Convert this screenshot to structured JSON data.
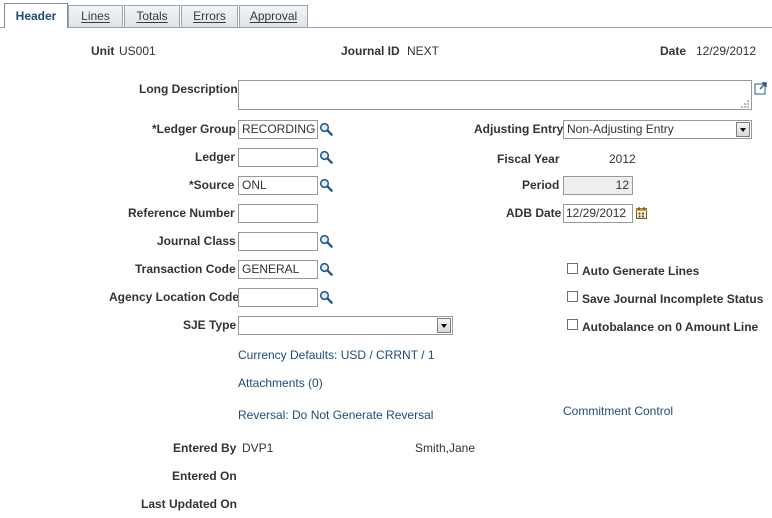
{
  "tabs": [
    {
      "label": "Header",
      "active": true
    },
    {
      "label": "Lines",
      "active": false
    },
    {
      "label": "Totals",
      "active": false
    },
    {
      "label": "Errors",
      "active": false
    },
    {
      "label": "Approval",
      "active": false
    }
  ],
  "header_info": {
    "unit_label": "Unit",
    "unit_value": "US001",
    "journal_id_label": "Journal ID",
    "journal_id_value": "NEXT",
    "date_label": "Date",
    "date_value": "12/29/2012"
  },
  "form": {
    "long_description_label": "Long Description",
    "long_description_value": "",
    "ledger_group_label": "*Ledger Group",
    "ledger_group_value": "RECORDING",
    "ledger_label": "Ledger",
    "ledger_value": "",
    "source_label": "*Source",
    "source_value": "ONL",
    "reference_number_label": "Reference Number",
    "reference_number_value": "",
    "journal_class_label": "Journal Class",
    "journal_class_value": "",
    "transaction_code_label": "Transaction Code",
    "transaction_code_value": "GENERAL",
    "agency_location_code_label": "Agency Location Code",
    "agency_location_code_value": "",
    "sje_type_label": "SJE Type",
    "sje_type_value": ""
  },
  "right_panel": {
    "adjusting_entry_label": "Adjusting Entry",
    "adjusting_entry_value": "Non-Adjusting Entry",
    "fiscal_year_label": "Fiscal Year",
    "fiscal_year_value": "2012",
    "period_label": "Period",
    "period_value": "12",
    "adb_date_label": "ADB Date",
    "adb_date_value": "12/29/2012"
  },
  "options": {
    "auto_generate_lines": {
      "label": "Auto Generate Lines",
      "checked": false
    },
    "save_incomplete": {
      "label": "Save Journal Incomplete Status",
      "checked": false
    },
    "autobalance": {
      "label": "Autobalance on 0 Amount Line",
      "checked": false
    }
  },
  "links": {
    "currency_defaults": "Currency Defaults: USD / CRRNT / 1",
    "attachments": "Attachments (0)",
    "reversal": "Reversal: Do Not Generate Reversal",
    "commitment_control": "Commitment Control"
  },
  "audit": {
    "entered_by_label": "Entered By",
    "entered_by_id": "DVP1",
    "entered_by_name": "Smith,Jane",
    "entered_on_label": "Entered On",
    "entered_on_value": "",
    "last_updated_label": "Last Updated On",
    "last_updated_value": ""
  },
  "icons": {
    "lookup": "magnifier-lookup-icon",
    "calendar": "calendar-icon",
    "expand": "expand-textarea-icon"
  },
  "colors": {
    "link": "#1f4b78",
    "label": "#333333",
    "tab_border": "#9aa6b2"
  }
}
